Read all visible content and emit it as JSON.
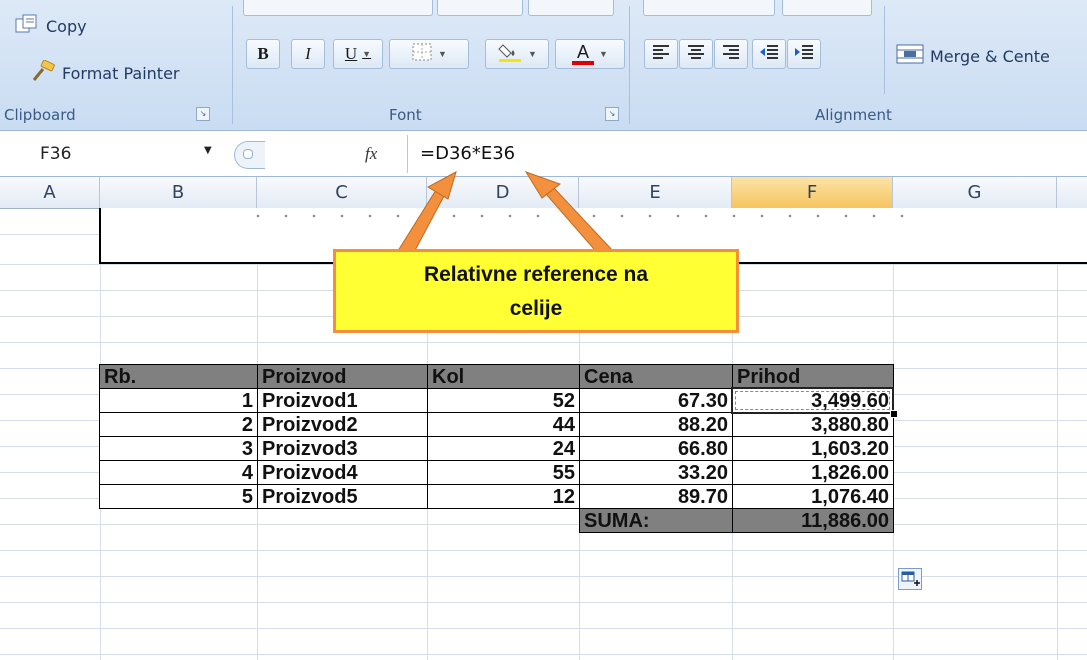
{
  "ribbon": {
    "clipboard": {
      "copy_label": "Copy",
      "format_painter_label": "Format Painter",
      "group_label": "Clipboard"
    },
    "font": {
      "bold": "B",
      "italic": "I",
      "underline": "U",
      "font_color_letter": "A",
      "group_label": "Font"
    },
    "alignment": {
      "merge_label": "Merge & Cente",
      "group_label": "Alignment"
    }
  },
  "formula_bar": {
    "name_box": "F36",
    "fx": "fx",
    "formula": "=D36*E36"
  },
  "columns": [
    "A",
    "B",
    "C",
    "D",
    "E",
    "F",
    "G"
  ],
  "selected_column": "F",
  "table": {
    "headers": [
      "Rb.",
      "Proizvod",
      "Kol",
      "Cena",
      "Prihod"
    ],
    "rows": [
      [
        "1",
        "Proizvod1",
        "52",
        "67.30",
        "3,499.60"
      ],
      [
        "2",
        "Proizvod2",
        "44",
        "88.20",
        "3,880.80"
      ],
      [
        "3",
        "Proizvod3",
        "24",
        "66.80",
        "1,603.20"
      ],
      [
        "4",
        "Proizvod4",
        "55",
        "33.20",
        "1,826.00"
      ],
      [
        "5",
        "Proizvod5",
        "12",
        "89.70",
        "1,076.40"
      ]
    ],
    "sum_label": "SUMA:",
    "sum_value": "11,886.00"
  },
  "callout": {
    "line1": "Relativne reference na",
    "line2": "celije"
  },
  "colors": {
    "header_fill": "#808080",
    "callout_fill": "#ffff33",
    "callout_border": "#f2903e",
    "arrow": "#f2903e",
    "selected_col": "#f6c55f",
    "ribbon_bg": "#dde9f7"
  }
}
